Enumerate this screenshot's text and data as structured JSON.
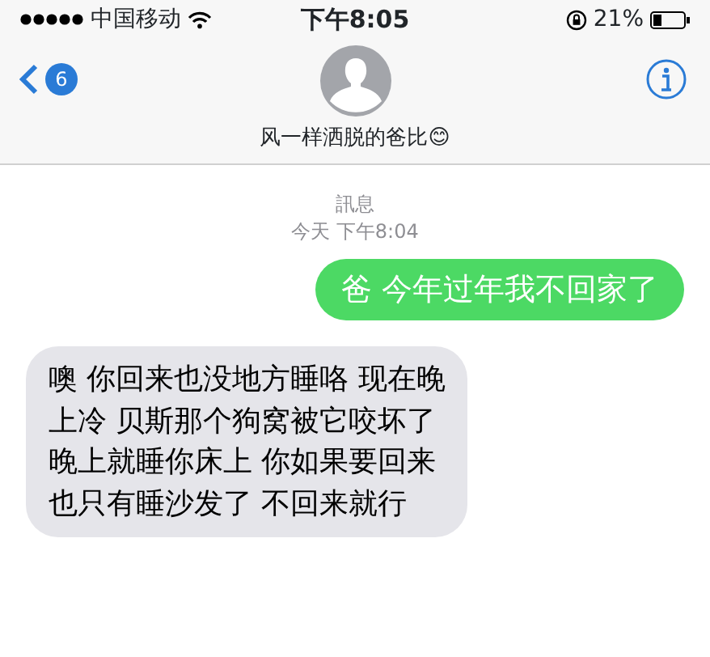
{
  "status_bar": {
    "carrier": "中国移动",
    "time": "下午8:05",
    "battery": "21%"
  },
  "header": {
    "back_count": "6",
    "contact_name": "风一样洒脱的爸比😊"
  },
  "thread": {
    "label": "訊息",
    "timestamp": "今天 下午8:04"
  },
  "messages": [
    {
      "kind": "sent",
      "lines": [
        "爸 今年过年我不回家了"
      ]
    },
    {
      "kind": "received",
      "lines": [
        "噢 你回来也没地方睡咯 现在晚",
        "上冷 贝斯那个狗窝被它咬坏了",
        "晚上就睡你床上 你如果要回来",
        "也只有睡沙发了 不回来就行"
      ]
    }
  ]
}
